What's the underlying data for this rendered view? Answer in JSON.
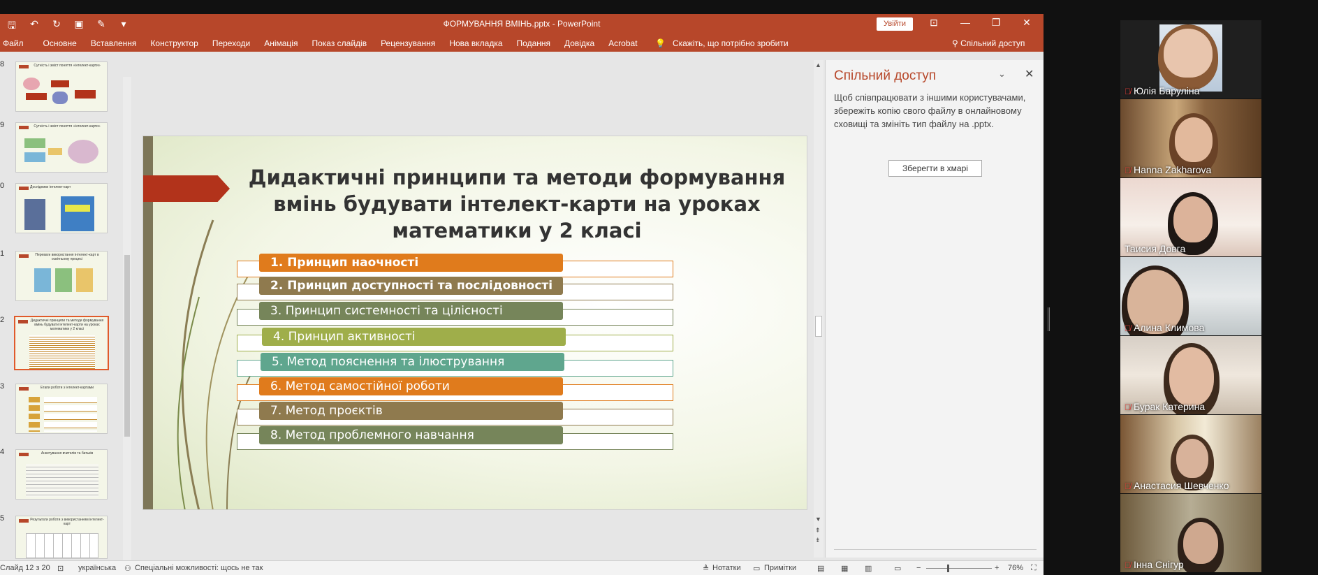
{
  "window": {
    "doc_title": "ФОРМУВАННЯ ВМІНЬ.pptx  -  PowerPoint",
    "login": "Увійти"
  },
  "ribbon": {
    "tabs": [
      "Файл",
      "Основне",
      "Вставлення",
      "Конструктор",
      "Переходи",
      "Анімація",
      "Показ слайдів",
      "Рецензування",
      "Нова вкладка",
      "Подання",
      "Довідка",
      "Acrobat"
    ],
    "tell_me": "Скажіть, що потрібно зробити",
    "share": "Спільний доступ"
  },
  "thumbnails": [
    {
      "num": "8",
      "title": "Сутність і зміст поняття «інтелект-карти»"
    },
    {
      "num": "9",
      "title": "Сутність і зміст поняття «інтелект-карти»"
    },
    {
      "num": "0",
      "title": "Дослідники інтелект-карт"
    },
    {
      "num": "1",
      "title": "Переваги використання інтелект-карт в освітньому процесі"
    },
    {
      "num": "2",
      "title": "Дидактичні принципи та методи формування вмінь будувати інтелект-карти на уроках математики у 2 класі"
    },
    {
      "num": "3",
      "title": "Етапи роботи з інтелект-картами"
    },
    {
      "num": "4",
      "title": "Анкетування вчителів та батьків"
    },
    {
      "num": "5",
      "title": "Результати роботи з використанням інтелект-карт"
    }
  ],
  "slide": {
    "title": "Дидактичні принципи та методи формування вмінь будувати інтелект-карти на уроках математики у 2 класі",
    "items": [
      {
        "text": "1. Принцип наочності",
        "color": "#e07b1c",
        "bold": true
      },
      {
        "text": "2. Принцип доступності та послідовності",
        "color": "#8f7a4e",
        "bold": true
      },
      {
        "text": "3. Принцип системності та цілісності",
        "color": "#76855a",
        "bold": false
      },
      {
        "text": "4. Принцип активності",
        "color": "#9fae4a",
        "bold": false
      },
      {
        "text": "5. Метод пояснення та ілюстрування",
        "color": "#5fa68e",
        "bold": false
      },
      {
        "text": "6. Метод самостійної роботи",
        "color": "#e07b1c",
        "bold": false
      },
      {
        "text": "7. Метод проєктів",
        "color": "#8f7a4e",
        "bold": false
      },
      {
        "text": "8. Метод проблемного навчання",
        "color": "#76855a",
        "bold": false
      }
    ]
  },
  "share_pane": {
    "title": "Спільний доступ",
    "text": "Щоб співпрацювати з іншими користувачами, збережіть копію свого файлу в онлайновому сховищі та змініть тип файлу на .pptx.",
    "button": "Зберегти в хмарі"
  },
  "statusbar": {
    "slide_info": "Слайд 12 з 20",
    "language": "українська",
    "accessibility": "Спеціальні можливості: щось не так",
    "notes": "Нотатки",
    "comments": "Примітки",
    "zoom": "76%"
  },
  "participants": [
    {
      "name": "Юлія Баруліна",
      "muted": true,
      "active": false
    },
    {
      "name": "Hanna Zakharova",
      "muted": true,
      "active": false
    },
    {
      "name": "Таисия Довга",
      "muted": false,
      "active": true
    },
    {
      "name": "Алина Климова",
      "muted": true,
      "active": false
    },
    {
      "name": "Бурак Катерина",
      "muted": true,
      "active": false
    },
    {
      "name": "Анастасия Шевченко",
      "muted": true,
      "active": false
    },
    {
      "name": "Інна Снігур",
      "muted": true,
      "active": false
    }
  ]
}
